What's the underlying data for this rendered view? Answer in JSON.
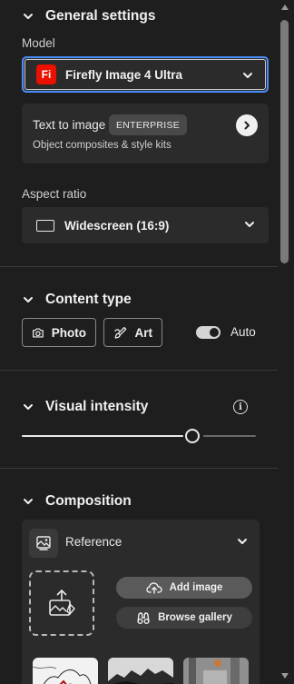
{
  "general": {
    "header": "General settings",
    "model_label": "Model",
    "model_logo": "Fi",
    "model_value": "Firefly Image 4 Ultra",
    "tti_title": "Text to image",
    "tti_badge": "ENTERPRISE",
    "tti_subtitle": "Object composites & style kits",
    "aspect_label": "Aspect ratio",
    "aspect_value": "Widescreen (16:9)"
  },
  "content_type": {
    "header": "Content type",
    "photo_label": "Photo",
    "art_label": "Art",
    "auto_label": "Auto",
    "auto_on": true
  },
  "visual_intensity": {
    "header": "Visual intensity",
    "info_glyph": "i",
    "level_fraction": 0.73
  },
  "composition": {
    "header": "Composition",
    "reference_label": "Reference",
    "add_image_label": "Add image",
    "browse_gallery_label": "Browse gallery"
  },
  "colors": {
    "accent_focus": "#4b8df8",
    "firefly_red": "#eb1000",
    "panel_bg": "#1e1e1e",
    "card_bg": "#2b2b2b"
  },
  "icons": [
    "chevron-down-icon",
    "chevron-right-icon",
    "aspect-ratio-icon",
    "camera-icon",
    "brush-icon",
    "info-icon",
    "reference-image-icon",
    "upload-image-icon",
    "cloud-upload-icon",
    "binoculars-icon"
  ]
}
